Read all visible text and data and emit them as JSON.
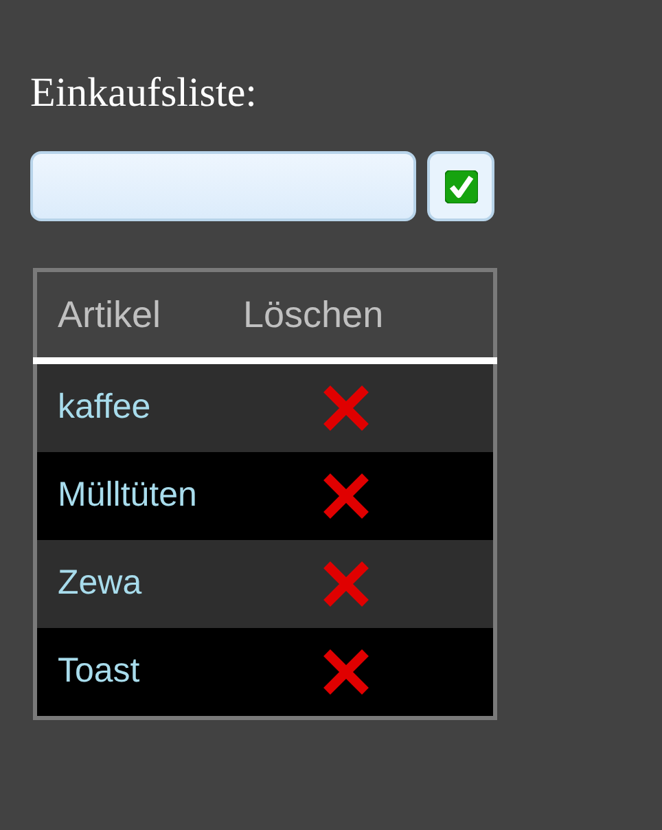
{
  "heading": "Einkaufsliste:",
  "table": {
    "columns": [
      "Artikel",
      "Löschen"
    ],
    "rows": [
      {
        "item": "kaffee"
      },
      {
        "item": "Mülltüten"
      },
      {
        "item": "Zewa"
      },
      {
        "item": "Toast"
      }
    ]
  }
}
